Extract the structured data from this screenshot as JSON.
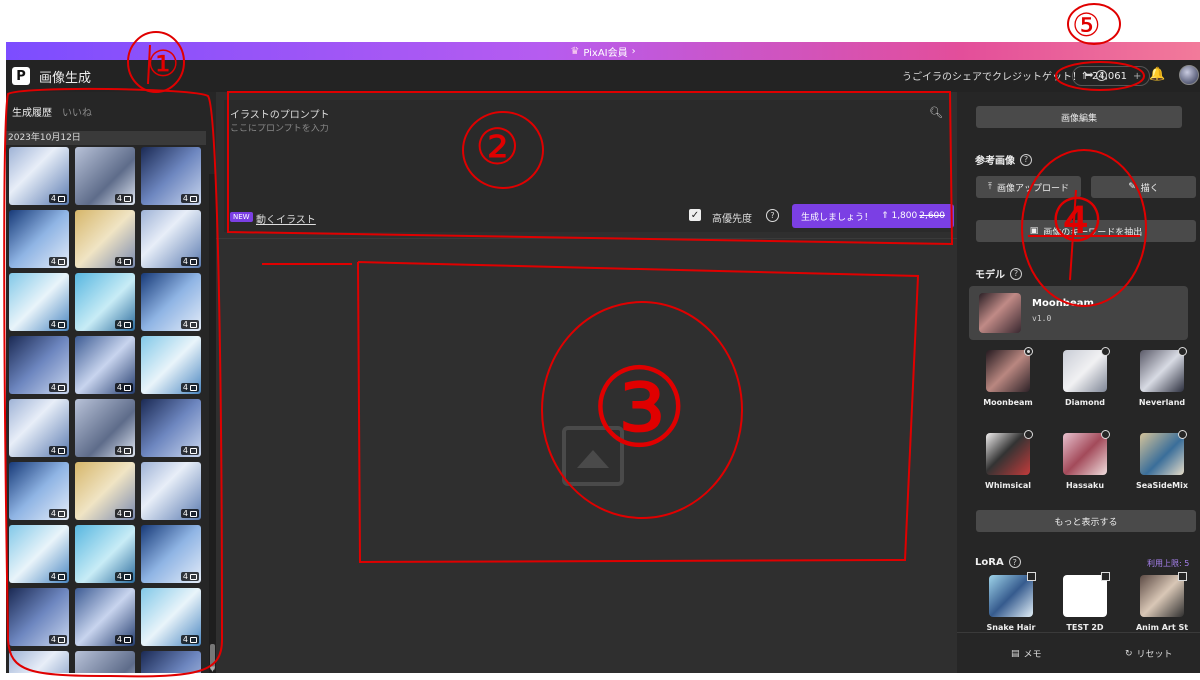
{
  "banner": {
    "label": "PixAI会員",
    "arrow": "›"
  },
  "header": {
    "logo": "P",
    "title": "画像生成",
    "promo": "うごイラのシェアでクレジットゲット！",
    "promo_arrow": "➡",
    "credits": "24,061",
    "credits_plus": "+"
  },
  "history": {
    "tab_active": "生成履歴",
    "tab_idle": "いいね",
    "date": "2023年10月12日",
    "badge_count": "4",
    "thumbnails": 27
  },
  "prompt": {
    "label": "イラストのプロンプト",
    "placeholder": "ここにプロンプトを入力",
    "new_tag": "NEW",
    "motion_link": "動くイラスト",
    "high_priority_label": "高優先度",
    "generate_label": "生成しましょう！",
    "cost": "1,800",
    "cost_original": "2,600"
  },
  "sidebar": {
    "edit_button": "画像編集",
    "reference_label": "参考画像",
    "upload_button": "画像アップロード",
    "draw_button": "描く",
    "mask_button": "画像のキーワードを抽出",
    "model_label": "モデル",
    "selected_model": {
      "name": "Moonbeam",
      "version": "v1.0"
    },
    "models": [
      "Moonbeam",
      "Diamond",
      "Neverland",
      "Whimsical",
      "Hassaku",
      "SeaSideMix"
    ],
    "more_button": "もっと表示する",
    "lora_label": "LoRA",
    "lora_limit": "利用上限: 5",
    "loras": [
      "Snake Hair",
      "TEST 2D",
      "Anim Art St"
    ],
    "memo": "メモ",
    "reset": "リセット"
  },
  "annotations": [
    "①",
    "②",
    "③",
    "④",
    "⑤"
  ],
  "colors": {
    "accent": "#7b3fe4",
    "annotation": "#e00000"
  }
}
